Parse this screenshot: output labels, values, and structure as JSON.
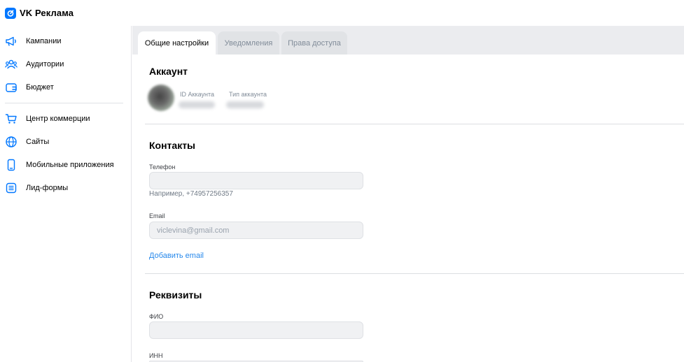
{
  "app": {
    "logo_text": "VK Реклама"
  },
  "sidebar": {
    "items": [
      {
        "label": "Кампании",
        "icon": "megaphone-icon"
      },
      {
        "label": "Аудитории",
        "icon": "users-icon"
      },
      {
        "label": "Бюджет",
        "icon": "wallet-icon"
      },
      {
        "label": "Центр коммерции",
        "icon": "cart-icon"
      },
      {
        "label": "Сайты",
        "icon": "globe-icon"
      },
      {
        "label": "Мобильные приложения",
        "icon": "phone-icon"
      },
      {
        "label": "Лид-формы",
        "icon": "form-icon"
      }
    ]
  },
  "tabs": [
    {
      "label": "Общие настройки",
      "active": true
    },
    {
      "label": "Уведомления",
      "active": false
    },
    {
      "label": "Права доступа",
      "active": false
    }
  ],
  "account": {
    "title": "Аккаунт",
    "id_label": "ID Аккаунта",
    "type_label": "Тип аккаунта"
  },
  "contacts": {
    "title": "Контакты",
    "phone_label": "Телефон",
    "phone_value": "",
    "phone_hint": "Например, +74957256357",
    "email_label": "Email",
    "email_value": "viclevina@gmail.com",
    "add_email": "Добавить email"
  },
  "requisites": {
    "title": "Реквизиты",
    "fio_label": "ФИО",
    "fio_value": "",
    "inn_label": "ИНН"
  },
  "colors": {
    "accent": "#0077ff",
    "link": "#2688eb",
    "tabbar": "#ebecef"
  }
}
